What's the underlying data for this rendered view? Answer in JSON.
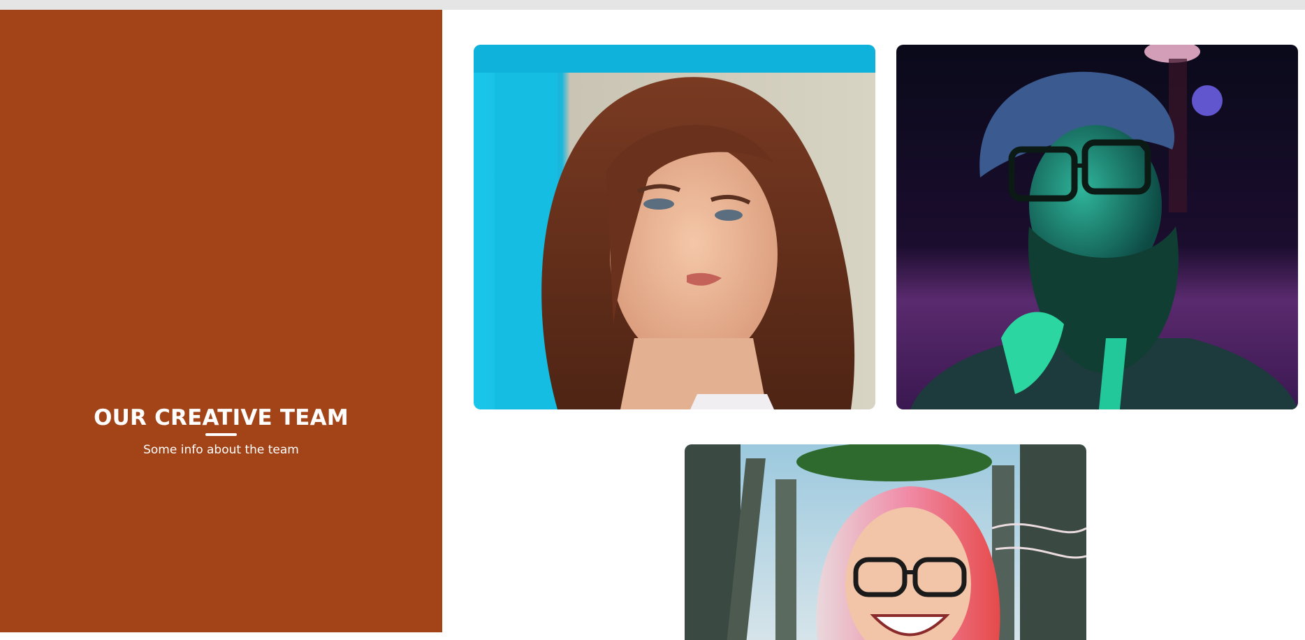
{
  "hero": {
    "title": "OUR CREATIVE TEAM",
    "subtitle": "Some info about the team",
    "background_color": "#a34418",
    "text_color": "#ffffff"
  },
  "team_photos": [
    {
      "subject": "woman-red-hair"
    },
    {
      "subject": "bearded-man-neon"
    },
    {
      "subject": "woman-pink-hair-glasses"
    }
  ]
}
